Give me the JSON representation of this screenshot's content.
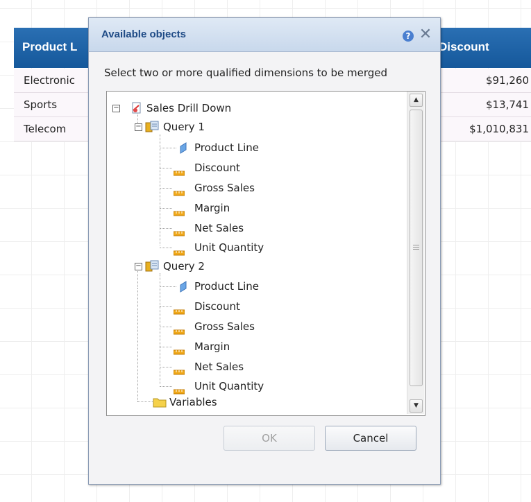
{
  "report": {
    "headers": {
      "product_line": "Product L",
      "discount": "Discount"
    },
    "rows": [
      {
        "category": "Electronic",
        "discount": "$91,260"
      },
      {
        "category": "Sports",
        "discount": "$13,741"
      },
      {
        "category": "Telecom",
        "discount": "$1,010,831"
      }
    ]
  },
  "dialog": {
    "title": "Available objects",
    "help_glyph": "?",
    "close_glyph": "✕",
    "instruction": "Select two or more qualified dimensions to be merged",
    "tree": {
      "root": "Sales Drill Down",
      "queries": [
        {
          "label": "Query 1",
          "dimension": "Product Line",
          "measures": [
            "Discount",
            "Gross Sales",
            "Margin",
            "Net Sales",
            "Unit Quantity"
          ]
        },
        {
          "label": "Query 2",
          "dimension": "Product Line",
          "measures": [
            "Discount",
            "Gross Sales",
            "Margin",
            "Net Sales",
            "Unit Quantity"
          ]
        }
      ],
      "variables": "Variables"
    },
    "buttons": {
      "ok": "OK",
      "cancel": "Cancel"
    }
  },
  "colors": {
    "header_blue": "#15589b",
    "dialog_title": "#1f4b86",
    "row_bg": "#fbf7fb"
  },
  "icons": {
    "root": "report-document-icon",
    "query": "query-cylinder-icon",
    "dimension": "dimension-blue-icon",
    "measure": "measure-ruler-icon",
    "folder": "folder-icon"
  }
}
